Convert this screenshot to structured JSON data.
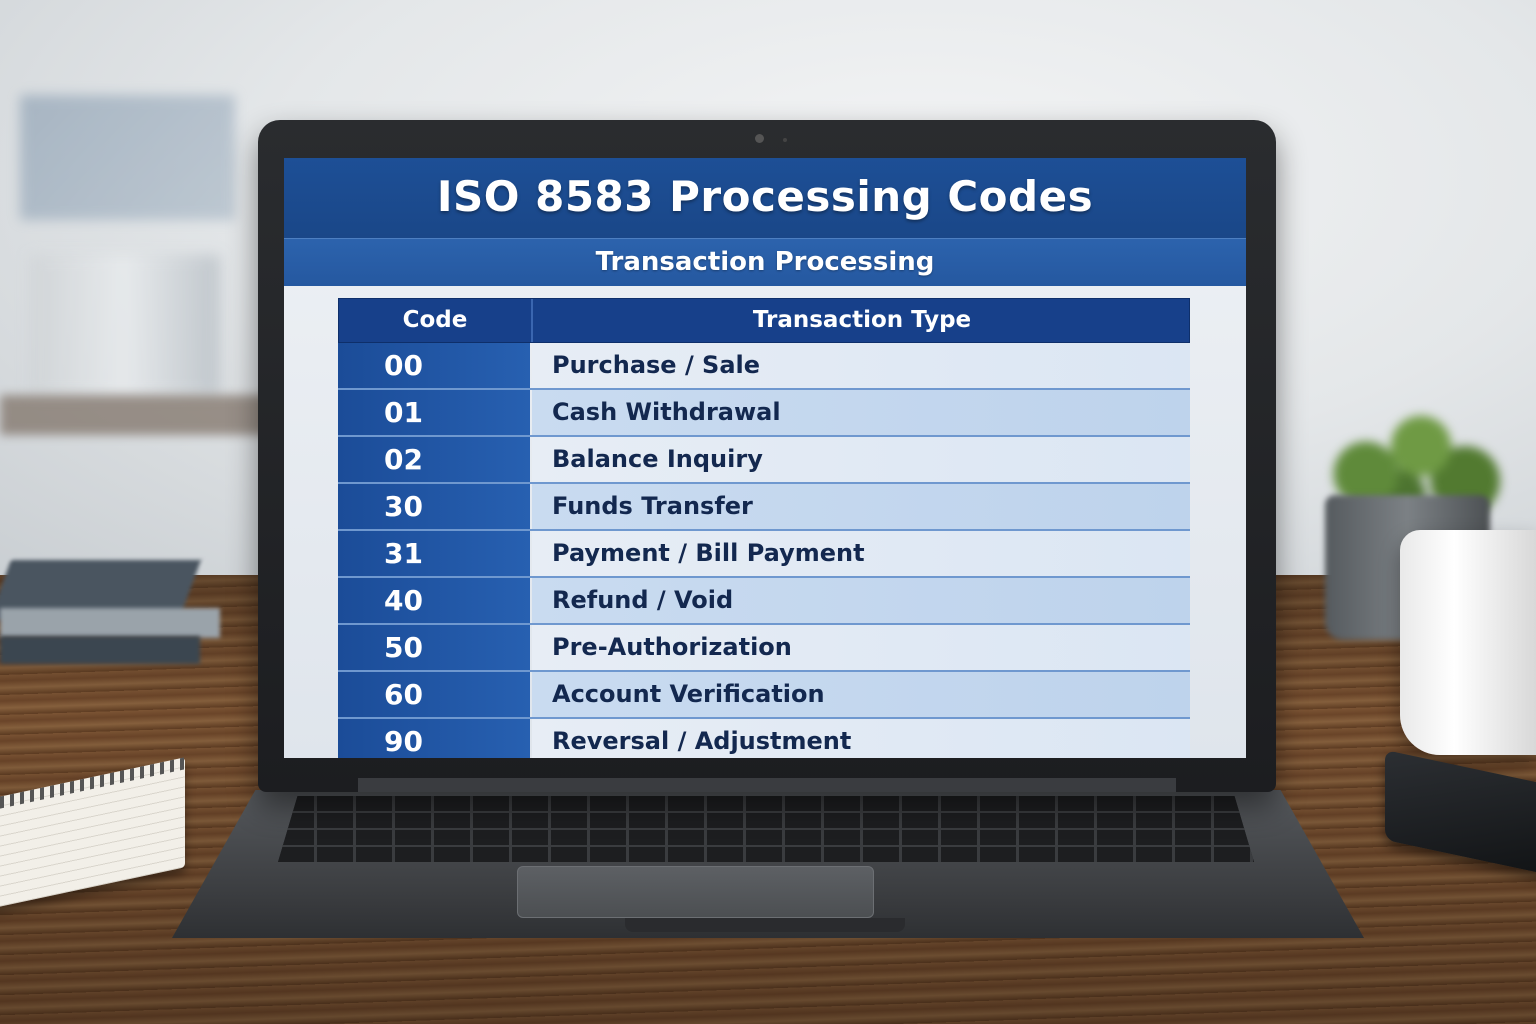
{
  "screen": {
    "title": "ISO 8583 Processing Codes",
    "subtitle": "Transaction Processing"
  },
  "table": {
    "headers": [
      "Code",
      "Transaction Type"
    ],
    "rows": [
      {
        "code": "00",
        "type": "Purchase / Sale"
      },
      {
        "code": "01",
        "type": "Cash Withdrawal"
      },
      {
        "code": "02",
        "type": "Balance Inquiry"
      },
      {
        "code": "30",
        "type": "Funds Transfer"
      },
      {
        "code": "31",
        "type": "Payment / Bill Payment"
      },
      {
        "code": "40",
        "type": "Refund / Void"
      },
      {
        "code": "50",
        "type": "Pre-Authorization"
      },
      {
        "code": "60",
        "type": "Account Verification"
      },
      {
        "code": "90",
        "type": "Reversal / Adjustment"
      }
    ]
  },
  "colors": {
    "header_blue": "#1d4f96",
    "subheader_blue": "#2c63ad",
    "code_cell_blue": "#1b4c98",
    "row_light": "#e7edf5",
    "row_alt": "#c9dbf0"
  }
}
